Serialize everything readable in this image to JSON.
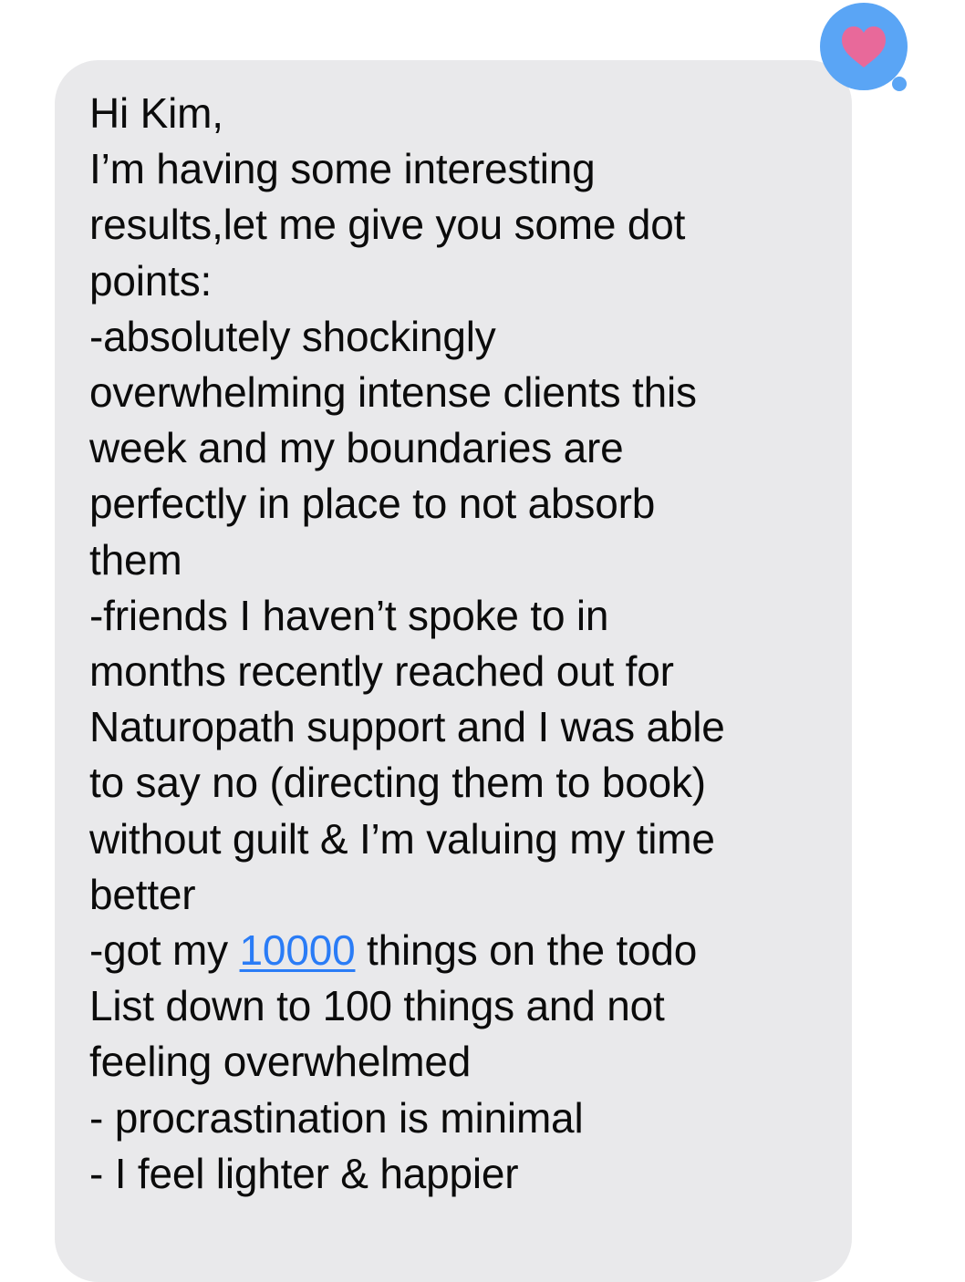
{
  "message": {
    "line_01": "Hi Kim,",
    "line_02": "I’m having some interesting",
    "line_03": "results,let me give you some dot",
    "line_04": "points:",
    "line_05": "-absolutely shockingly",
    "line_06": "overwhelming intense clients this",
    "line_07": "week and my boundaries are",
    "line_08": "perfectly in place to not absorb",
    "line_09": "them",
    "line_10": "-friends I haven’t spoke to in",
    "line_11": "months recently reached out for",
    "line_12": "Naturopath support and I was able",
    "line_13": "to say no (directing them to book)",
    "line_14": "without guilt & I’m valuing my time",
    "line_15": "better",
    "line_16_before": "-got my ",
    "line_16_link": "10000",
    "line_16_after": " things on the todo",
    "line_17": "List down to 100 things and not",
    "line_18": "feeling overwhelmed",
    "line_19": "- procrastination is minimal",
    "line_20": "- I feel lighter & happier"
  },
  "tapback": {
    "icon": "heart-icon",
    "bubble_color": "#5aa5f5",
    "heart_color": "#e8699a"
  },
  "colors": {
    "bubble_background": "#e9e9eb",
    "text": "#0b0b0b",
    "link": "#2a7cf6"
  }
}
